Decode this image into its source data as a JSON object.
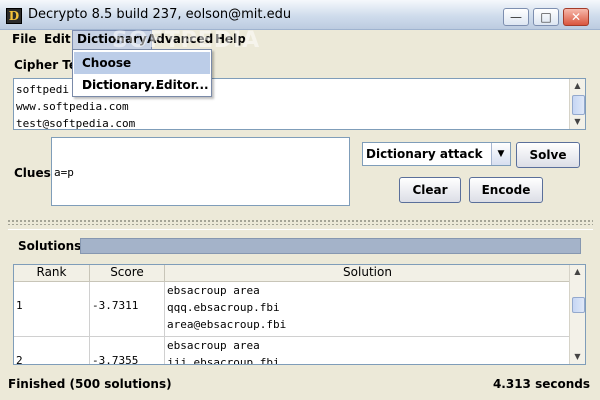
{
  "window": {
    "title": "Decrypto 8.5 build 237, eolson@mit.edu",
    "app_icon_letter": "D",
    "minimize_glyph": "—",
    "maximize_glyph": "□",
    "close_glyph": "✕"
  },
  "menu": [
    "File",
    "Edit",
    "Dictionary",
    "Advanced",
    "Help"
  ],
  "dictionary_menu": {
    "items": [
      "Choose Dictionary...",
      "Dictionary Editor..."
    ],
    "highlighted": "Choose Dictionary..."
  },
  "cipher": {
    "label": "Cipher Tex",
    "lines": [
      "softpedi",
      "www.softpedia.com",
      "test@softpedia.com"
    ]
  },
  "clues": {
    "label": "Clues",
    "value": "a=p"
  },
  "attack": {
    "selected": "Dictionary attack"
  },
  "buttons": {
    "solve": "Solve",
    "clear": "Clear",
    "encode": "Encode"
  },
  "solutions": {
    "label": "Solutions:",
    "columns": [
      "Rank",
      "Score",
      "Solution"
    ],
    "rows": [
      {
        "rank": "1",
        "score": "-3.7311",
        "lines": [
          "ebsacroup area",
          "qqq.ebsacroup.fbi",
          "area@ebsacroup.fbi"
        ]
      },
      {
        "rank": "2",
        "score": "-3.7355",
        "lines": [
          "ebsacroup area",
          "jjj.ebsacroup.fbi",
          ""
        ]
      }
    ]
  },
  "status": {
    "left": "Finished (500 solutions)",
    "right": "4.313 seconds"
  },
  "watermark": "SOFTPEDIA"
}
